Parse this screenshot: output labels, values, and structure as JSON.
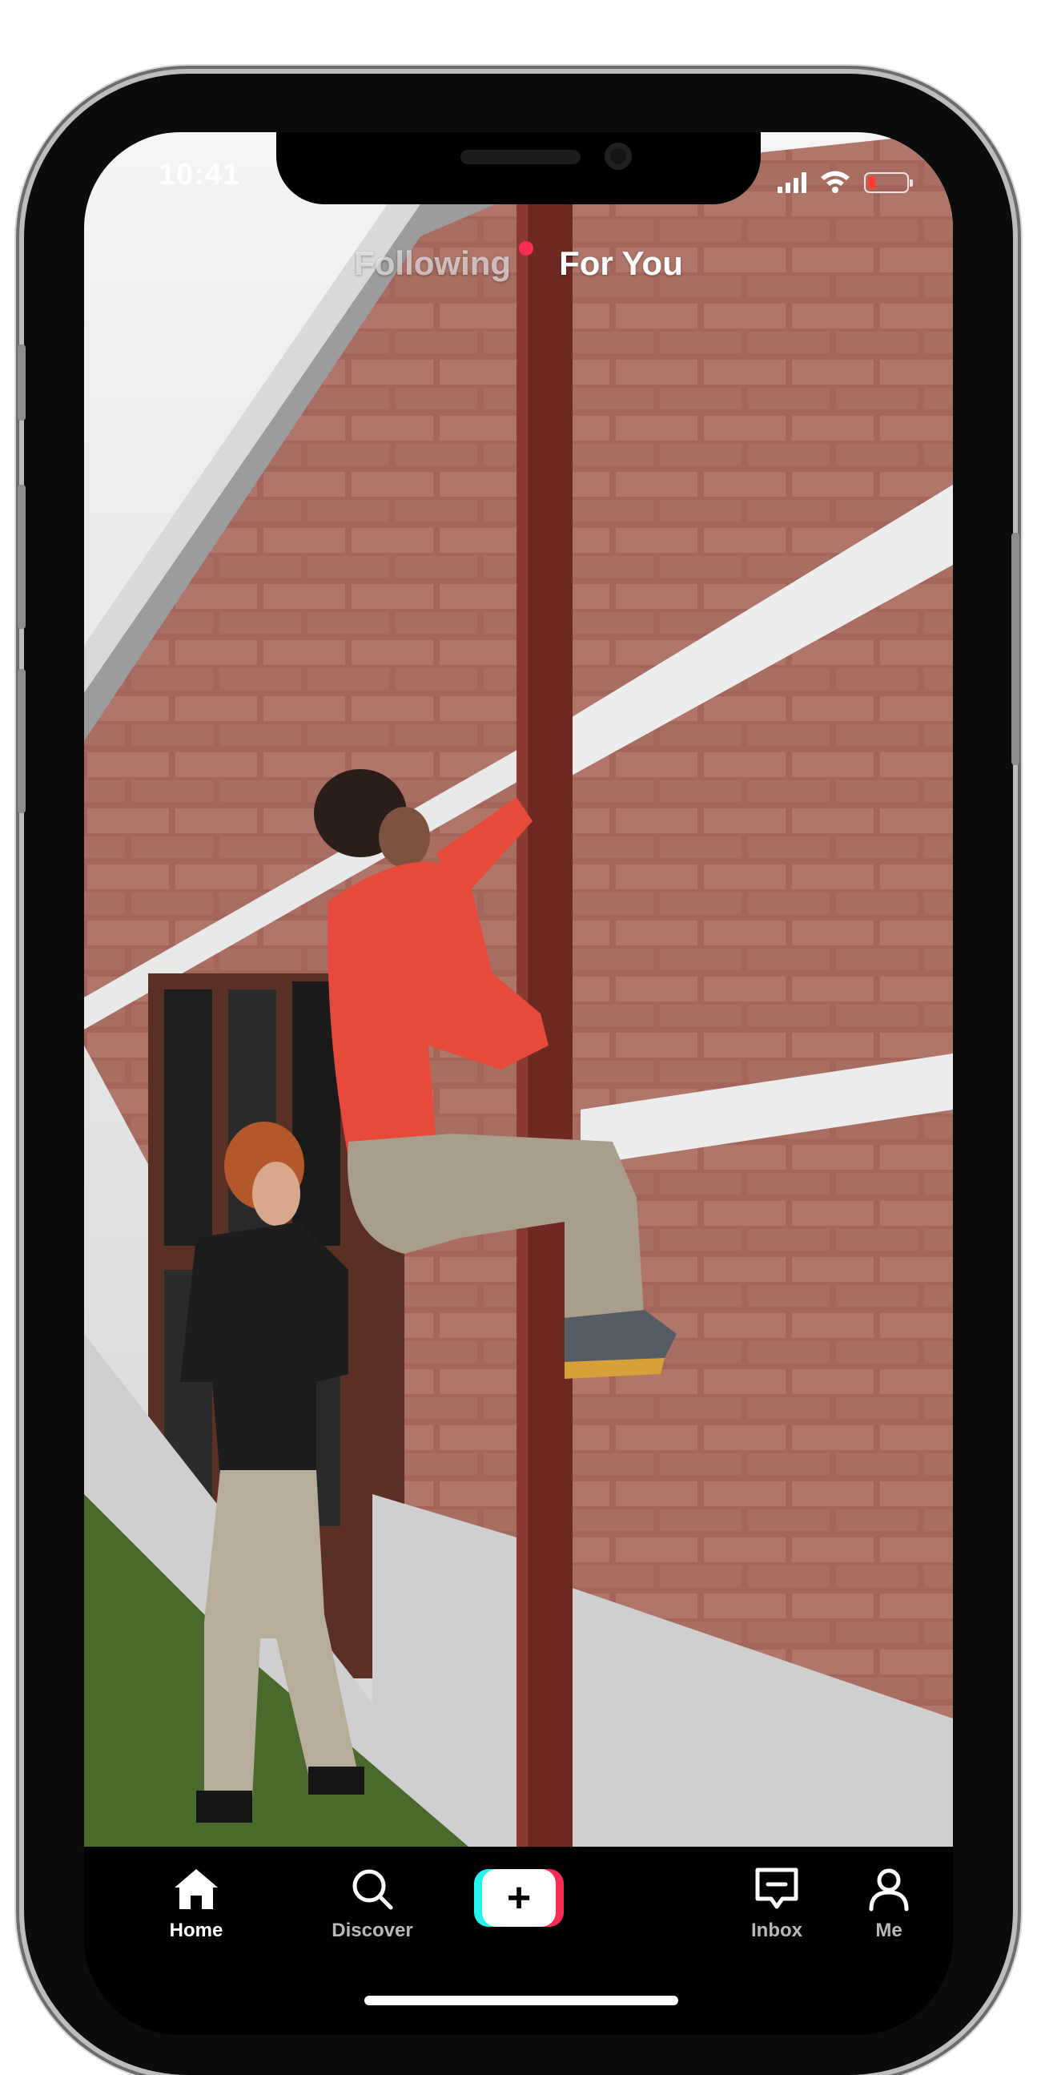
{
  "status_bar": {
    "time": "10:41",
    "battery_level": 0.2,
    "battery_color": "#ff3b30"
  },
  "top_tabs": {
    "following": "Following",
    "for_you": "For You",
    "notification_dot_color": "#fe2c55"
  },
  "video": {
    "description": "Video frame: a student in a red shirt climbs a brown pole against a brick wall while another student watches"
  },
  "bottom_nav": {
    "home": "Home",
    "discover": "Discover",
    "create": "+",
    "inbox": "Inbox",
    "me": "Me"
  },
  "colors": {
    "accent_pink": "#fe2c55",
    "accent_cyan": "#25f4ee",
    "nav_background": "#000000"
  }
}
